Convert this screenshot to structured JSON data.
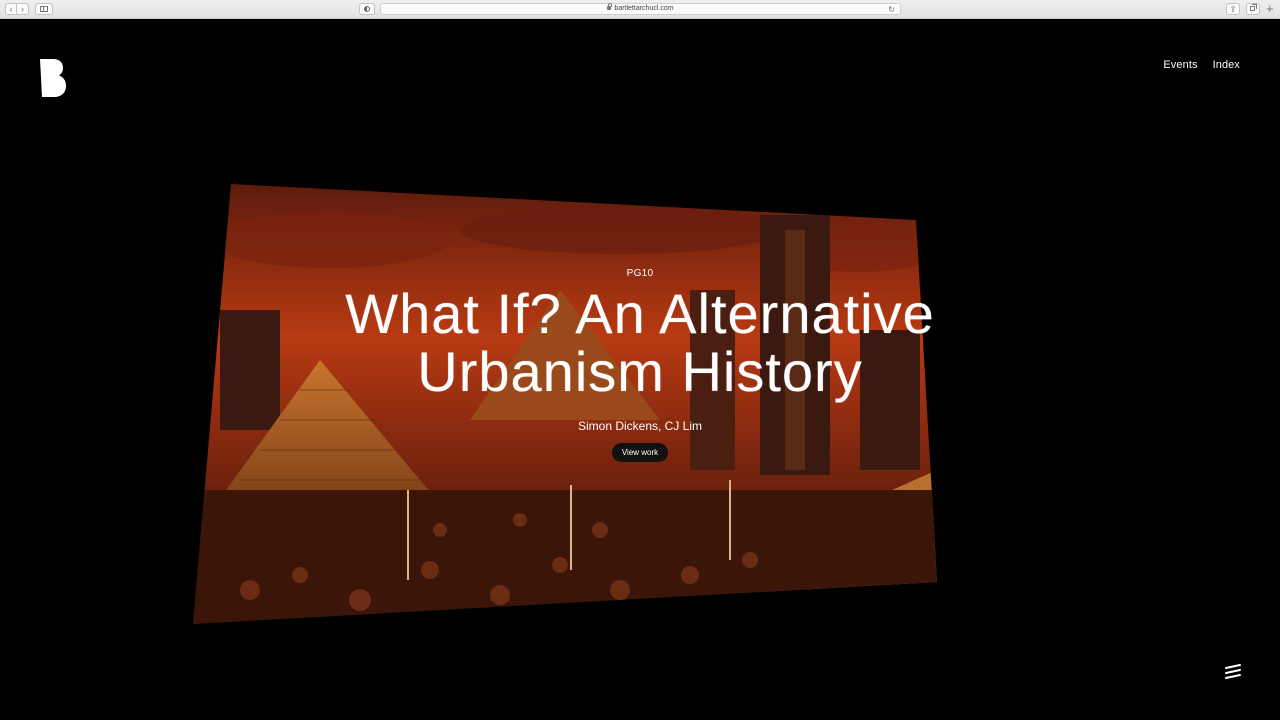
{
  "browser": {
    "url": "bartlettarchucl.com",
    "reload_glyph": "↻",
    "share_glyph": "⇪",
    "back_glyph": "‹",
    "forward_glyph": "›",
    "new_tab_glyph": "+"
  },
  "nav": {
    "logo_icon": "bartlett-b-logo",
    "items": [
      {
        "label": "Events"
      },
      {
        "label": "Index"
      }
    ]
  },
  "hero": {
    "tag": "PG10",
    "title_line1": "What If? An Alternative",
    "title_line2": "Urbanism History",
    "authors": "Simon Dickens, CJ Lim",
    "cta_label": "View work",
    "image_icon": "pixel-city-artwork"
  },
  "footer": {
    "menu_icon": "stack-menu-icon"
  },
  "colors": {
    "background": "#000000",
    "text": "#ffffff",
    "hero_sky": "#b83a12",
    "hero_ground": "#2a0f08"
  }
}
